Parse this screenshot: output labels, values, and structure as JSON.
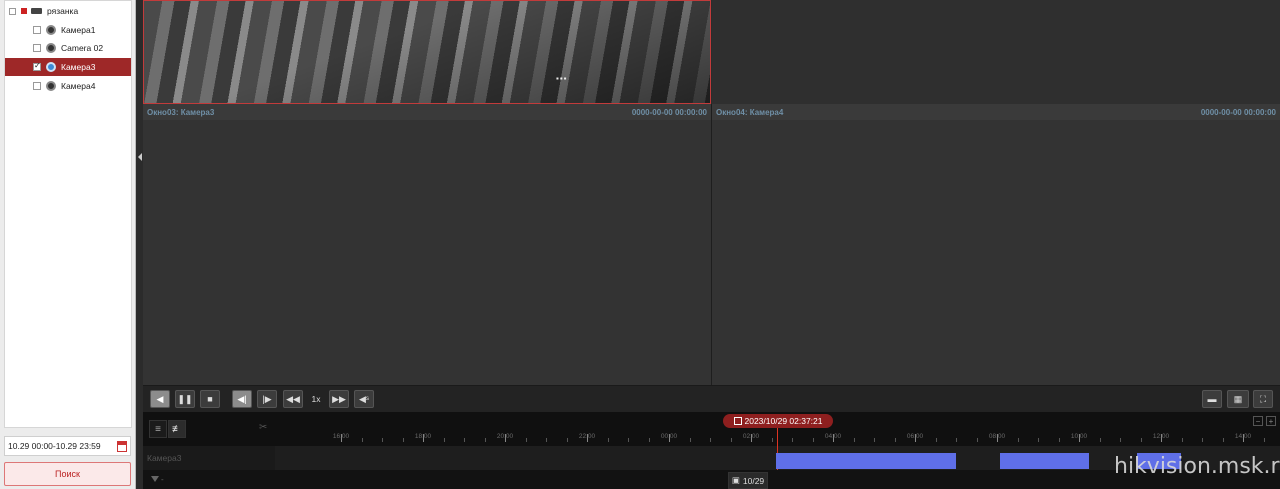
{
  "tree": {
    "items": [
      {
        "label": "рязанка",
        "type": "nvr",
        "checked": false,
        "selected": false
      },
      {
        "label": "Камера1",
        "type": "camera",
        "checked": false,
        "selected": false
      },
      {
        "label": "Camera 02",
        "type": "camera",
        "checked": false,
        "selected": false
      },
      {
        "label": "Камера3",
        "type": "camera",
        "checked": true,
        "selected": true
      },
      {
        "label": "Камера4",
        "type": "camera",
        "checked": false,
        "selected": false
      }
    ]
  },
  "search": {
    "date_range": "10.29 00:00-10.29 23:59",
    "button_label": "Поиск"
  },
  "panes": {
    "pane3": {
      "window": "Окно03:",
      "camera": "Камера3",
      "time": "0000-00-00 00:00:00"
    },
    "pane4": {
      "window": "Окно04:",
      "camera": "Камера4",
      "time": "0000-00-00 00:00:00"
    }
  },
  "controls": {
    "speed": "1x"
  },
  "timeline": {
    "current_datetime": "2023/10/29 02:37:21",
    "track_name": "Камера3",
    "labels": [
      "16:00",
      "18:00",
      "20:00",
      "22:00",
      "00:00",
      "02:00",
      "04:00",
      "06:00",
      "08:00",
      "10:00",
      "12:00",
      "14:00"
    ],
    "recordings": [
      {
        "start": "02:37",
        "end": "07:00"
      },
      {
        "start": "08:05",
        "end": "10:15"
      },
      {
        "start": "11:25",
        "end": "12:30"
      }
    ],
    "day_chip": "10/29",
    "filter_text": "-"
  },
  "watermark": "hikvision.msk.ru",
  "colors": {
    "accent": "#9e2828",
    "recording": "#5f6fe8",
    "pane_label": "#6f8fa6"
  }
}
